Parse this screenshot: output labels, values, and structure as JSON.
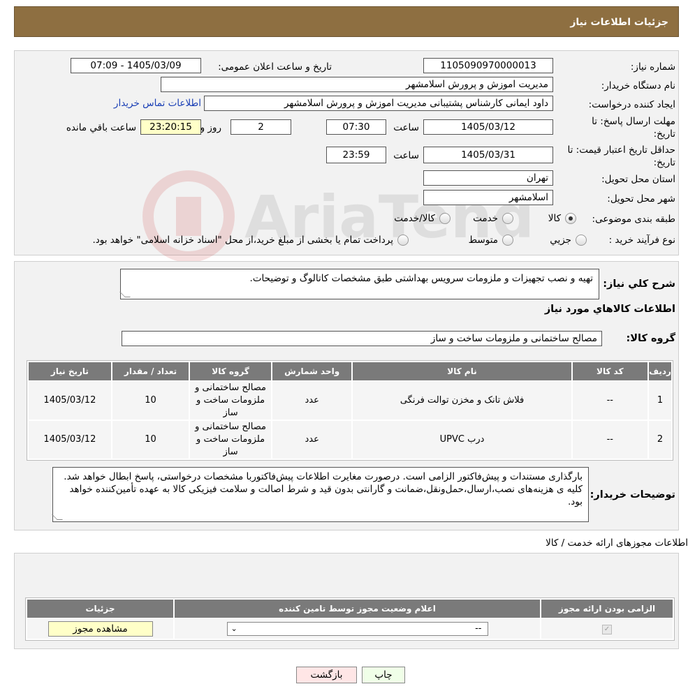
{
  "header": {
    "title": "جزئیات اطلاعات نیاز"
  },
  "fields": {
    "need_number_label": "شماره نیاز:",
    "need_number": "1105090970000013",
    "announce_label": "تاریخ و ساعت اعلان عمومی:",
    "announce_value": "1405/03/09 - 07:09",
    "buyer_org_label": "نام دستگاه خریدار:",
    "buyer_org": "مدیریت اموزش و پرورش اسلامشهر",
    "creator_label": "ایجاد کننده درخواست:",
    "creator": "داود ایمانی کارشناس پشتیبانی مدیریت اموزش و پرورش اسلامشهر",
    "contact_link": "اطلاعات تماس خریدار",
    "deadline_label_1": "مهلت ارسال پاسخ: تا",
    "deadline_label_2": "تاریخ:",
    "deadline_date": "1405/03/12",
    "time_label": "ساعت",
    "deadline_time": "07:30",
    "days_value": "2",
    "days_label": "روز و",
    "remaining_time": "23:20:15",
    "remaining_label": "ساعت باقي مانده",
    "validity_label_1": "حداقل تاریخ اعتبار قیمت: تا",
    "validity_label_2": "تاریخ:",
    "validity_date": "1405/03/31",
    "validity_time": "23:59",
    "province_label": "استان محل تحویل:",
    "province": "تهران",
    "city_label": "شهر محل تحویل:",
    "city": "اسلامشهر",
    "category_label": "طبقه بندی موضوعی:",
    "category_options": [
      "کالا",
      "خدمت",
      "کالا/خدمت"
    ],
    "process_label": "نوع فرآیند خرید :",
    "process_options": [
      "جزیي",
      "متوسط"
    ],
    "process_note": "پرداخت تمام یا بخشی از مبلغ خرید،از محل \"اسناد خزانه اسلامی\" خواهد بود."
  },
  "description": {
    "label": "شرح کلي نیاز:",
    "text": "تهیه و نصب تجهیزات و ملزومات سرویس بهداشتی طبق مشخصات کاتالوگ و توضیحات."
  },
  "goods": {
    "section_title": "اطلاعات کالاهاي مورد نیاز",
    "group_label": "گروه کالا:",
    "group_value": "مصالح ساختمانی و ملزومات ساخت و ساز",
    "columns": [
      "ردیف",
      "کد کالا",
      "نام کالا",
      "واحد شمارش",
      "گروه کالا",
      "تعداد / مقدار",
      "تاریخ نیاز"
    ],
    "rows": [
      {
        "idx": "1",
        "code": "--",
        "name": "فلاش تانک و مخزن توالت فرنگی",
        "unit": "عدد",
        "group": "مصالح ساختمانی و ملزومات ساخت و ساز",
        "qty": "10",
        "date": "1405/03/12"
      },
      {
        "idx": "2",
        "code": "--",
        "name": "درب UPVC",
        "unit": "عدد",
        "group": "مصالح ساختمانی و ملزومات ساخت و ساز",
        "qty": "10",
        "date": "1405/03/12"
      }
    ]
  },
  "buyer_notes": {
    "label": "توضیحات خریدار:",
    "text": "بارگذاری مستندات و پیش‌فاکتور الزامی است. درصورت مغایرت اطلاعات پیش‌فاکتوربا مشخصات درخواستی، پاسخ ابطال خواهد شد. کلیه ی هزینه‌های نصب،ارسال،حمل‌ونقل،ضمانت و گارانتی بدون قید و شرط اصالت و سلامت فیزیکی کالا به عهده تأمین‌کننده خواهد بود."
  },
  "licenses": {
    "section_title": "اطلاعات مجوزهای ارائه خدمت / کالا",
    "columns": [
      "الزامی بودن ارائه مجوز",
      "اعلام وضعیت مجوز توسط تامین کننده",
      "جزئیات"
    ],
    "select_value": "--",
    "view_button": "مشاهده مجوز"
  },
  "footer": {
    "print_button": "چاپ",
    "back_button": "بازگشت"
  },
  "watermark": {
    "text": "AriaTender.neT"
  },
  "colors": {
    "header_bg": "#8e6f41",
    "table_header": "#7a7a7a",
    "yellow": "#ffffc8"
  }
}
